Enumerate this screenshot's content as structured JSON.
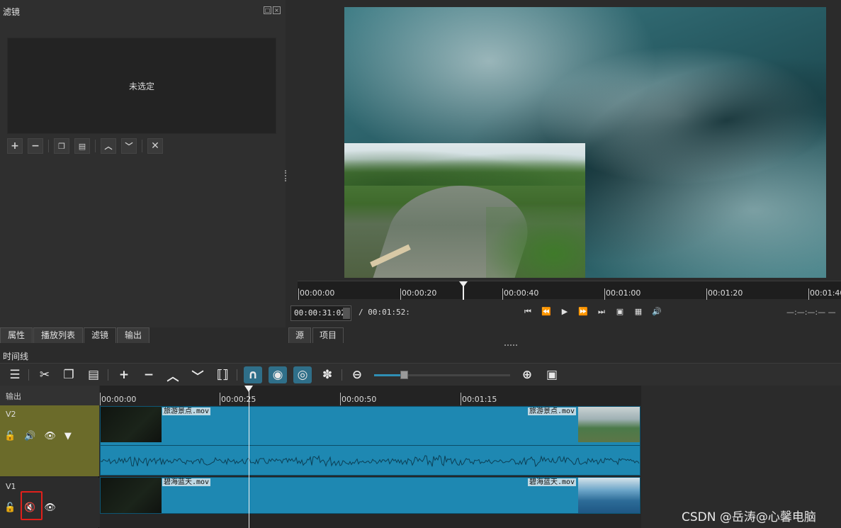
{
  "filters_panel": {
    "title": "滤镜",
    "empty_text": "未选定",
    "float_icon": "float-icon",
    "close_icon": "close-icon",
    "toolbar": [
      "add-icon",
      "remove-icon",
      "copy-icon",
      "paste-icon",
      "move-up-icon",
      "move-down-icon",
      "deselect-icon"
    ]
  },
  "left_tabs": [
    {
      "label": "属性"
    },
    {
      "label": "播放列表"
    },
    {
      "label": "滤镜"
    },
    {
      "label": "输出"
    }
  ],
  "viewer": {
    "ruler_labels": [
      "00:00:00",
      "00:00:20",
      "00:00:40",
      "00:01:00",
      "00:01:20",
      "00:01:40"
    ],
    "timecode": "00:00:31:02",
    "duration": "/ 00:01:52:",
    "out_point": "—:—:—:— —",
    "tabs": [
      {
        "label": "源"
      },
      {
        "label": "项目"
      }
    ]
  },
  "timeline": {
    "title": "时间线",
    "ruler_labels": [
      "00:00:00",
      "00:00:25",
      "00:00:50",
      "00:01:15"
    ],
    "tracks": {
      "output_label": "输出",
      "v2": {
        "name": "V2",
        "clip_label_start": "旅游景点.mov",
        "clip_label_end": "旅游景点.mov"
      },
      "v1": {
        "name": "V1",
        "clip_label_start": "碧海蓝天.mov",
        "clip_label_end": "碧海蓝天.mov"
      }
    },
    "zoom_level": 0.22,
    "colors": {
      "clip": "#1e88b2",
      "v2_header": "#6b6b2a",
      "highlight": "#e0201b",
      "toggle_on": "#2f6f89"
    }
  },
  "watermark": "CSDN @岳涛@心馨电脑"
}
